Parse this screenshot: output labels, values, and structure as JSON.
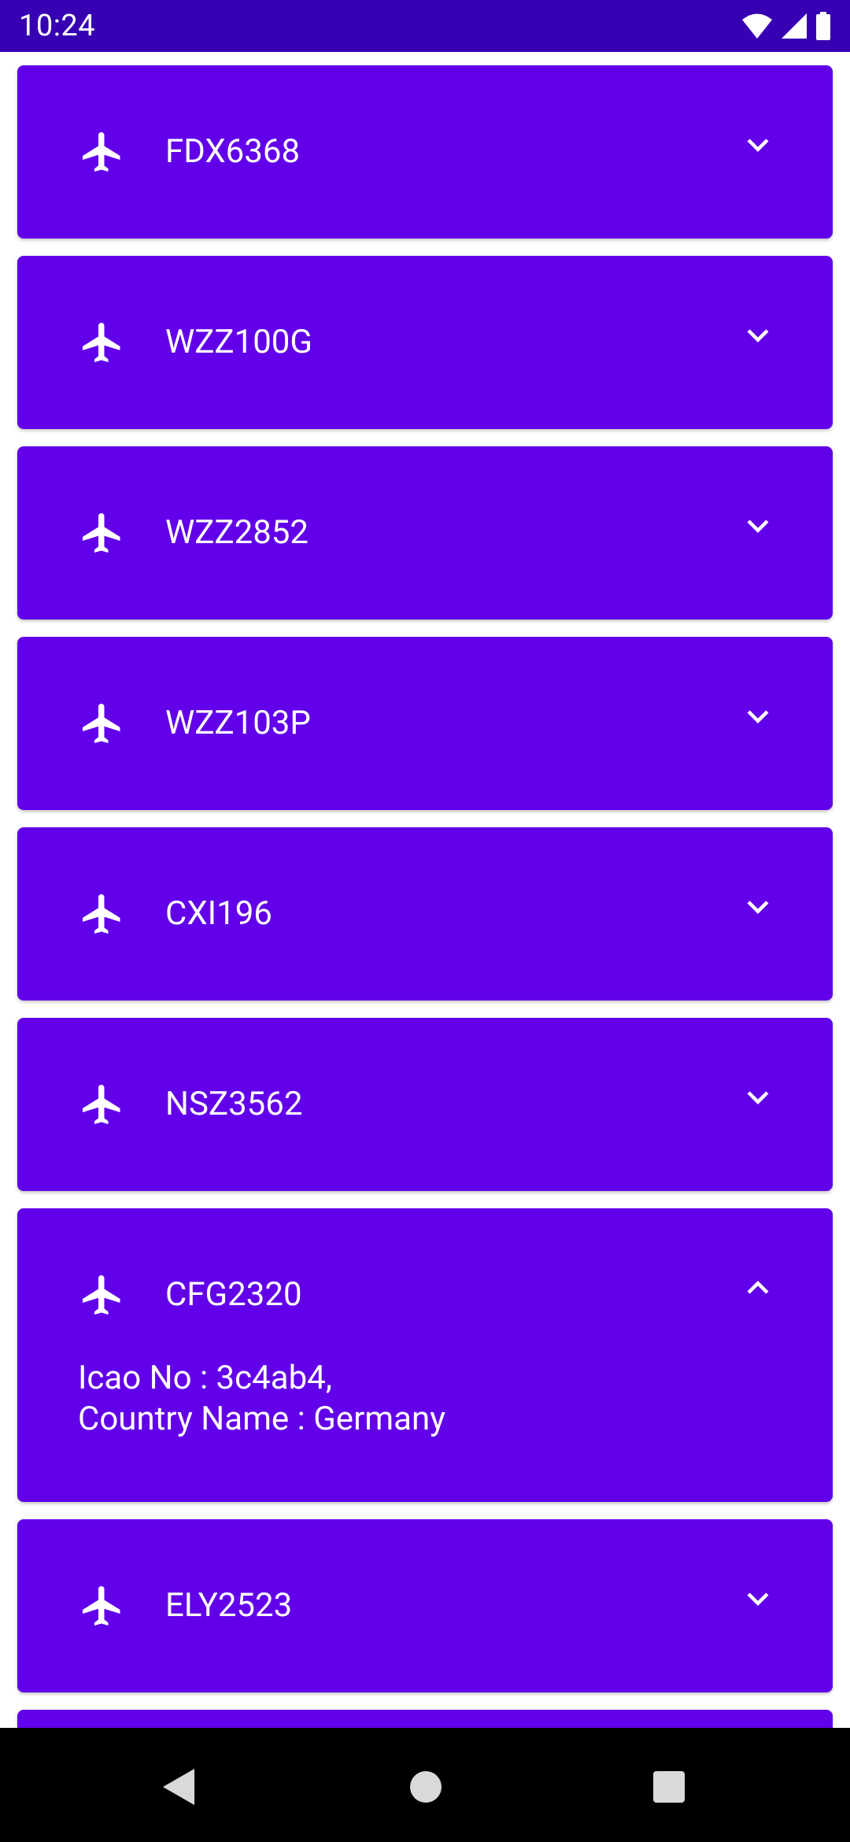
{
  "status_bar": {
    "time": "10:24"
  },
  "flights": [
    {
      "callsign": "FDX6368",
      "expanded": false
    },
    {
      "callsign": "WZZ100G",
      "expanded": false
    },
    {
      "callsign": "WZZ2852",
      "expanded": false
    },
    {
      "callsign": "WZZ103P",
      "expanded": false
    },
    {
      "callsign": "CXI196",
      "expanded": false
    },
    {
      "callsign": "NSZ3562",
      "expanded": false
    },
    {
      "callsign": "CFG2320",
      "expanded": true,
      "icao_line": "Icao No : 3c4ab4,",
      "country_line": "Country Name : Germany"
    },
    {
      "callsign": "ELY2523",
      "expanded": false
    }
  ],
  "icons": {
    "plane": "airplane-icon",
    "expand": "chevron-down-icon",
    "collapse": "chevron-up-icon",
    "nav_back": "back-triangle-icon",
    "nav_home": "home-circle-icon",
    "nav_recents": "recents-square-icon"
  },
  "colors": {
    "status_bar": "#3700b3",
    "card": "#6200ea",
    "text": "#ffffff"
  }
}
